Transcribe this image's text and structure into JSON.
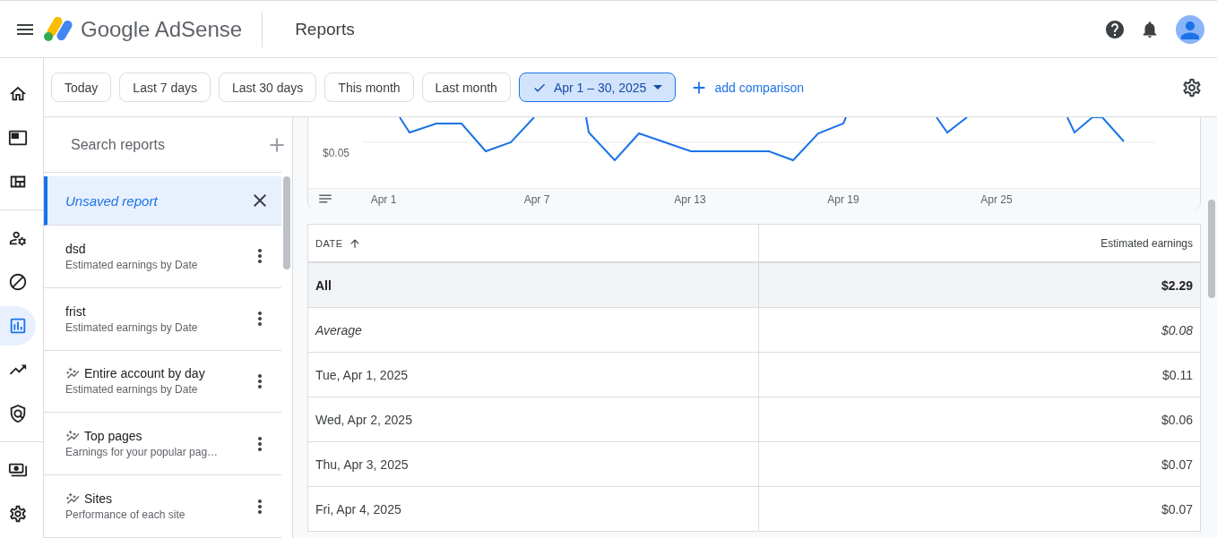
{
  "header": {
    "product": "Google AdSense",
    "page_title": "Reports"
  },
  "rail": {
    "groups": [
      [
        {
          "selected": false
        },
        {
          "selected": false
        },
        {
          "selected": false
        }
      ],
      [
        {
          "selected": false
        },
        {
          "selected": false
        },
        {
          "selected": true
        },
        {
          "selected": false
        },
        {
          "selected": false
        }
      ],
      [
        {
          "selected": false
        },
        {
          "selected": false
        }
      ]
    ]
  },
  "date_filters": [
    {
      "label": "Today",
      "selected": false
    },
    {
      "label": "Last 7 days",
      "selected": false
    },
    {
      "label": "Last 30 days",
      "selected": false
    },
    {
      "label": "This month",
      "selected": false
    },
    {
      "label": "Last month",
      "selected": false
    },
    {
      "label": "Apr 1 – 30, 2025",
      "selected": true
    }
  ],
  "add_comparison": "add comparison",
  "report_list": {
    "search": {
      "placeholder": "Search reports"
    },
    "items": [
      {
        "kind": "unsaved",
        "title": "Unsaved report",
        "selected": true
      },
      {
        "kind": "saved",
        "title": "dsd",
        "subtitle": "Estimated earnings by Date",
        "selected": false
      },
      {
        "kind": "saved",
        "title": "frist",
        "subtitle": "Estimated earnings by Date",
        "selected": false
      },
      {
        "kind": "template",
        "title": "Entire account by day",
        "subtitle": "Estimated earnings by Date",
        "selected": false
      },
      {
        "kind": "template",
        "title": "Top pages",
        "subtitle": "Earnings for your popular pag…",
        "selected": false
      },
      {
        "kind": "template",
        "title": "Sites",
        "subtitle": "Performance of each site",
        "selected": false
      }
    ]
  },
  "chart": {
    "y_label": "$0.05",
    "x_labels": [
      "Apr 1",
      "Apr 7",
      "Apr 13",
      "Apr 19",
      "Apr 25"
    ]
  },
  "table": {
    "columns": [
      "DATE",
      "Estimated earnings"
    ],
    "rows": [
      {
        "kind": "total",
        "date": "All",
        "earnings": "$2.29"
      },
      {
        "kind": "average",
        "date": "Average",
        "earnings": "$0.08"
      },
      {
        "kind": "day",
        "date": "Tue, Apr 1, 2025",
        "earnings": "$0.11"
      },
      {
        "kind": "day",
        "date": "Wed, Apr 2, 2025",
        "earnings": "$0.06"
      },
      {
        "kind": "day",
        "date": "Thu, Apr 3, 2025",
        "earnings": "$0.07"
      },
      {
        "kind": "day",
        "date": "Fri, Apr 4, 2025",
        "earnings": "$0.07"
      }
    ]
  }
}
